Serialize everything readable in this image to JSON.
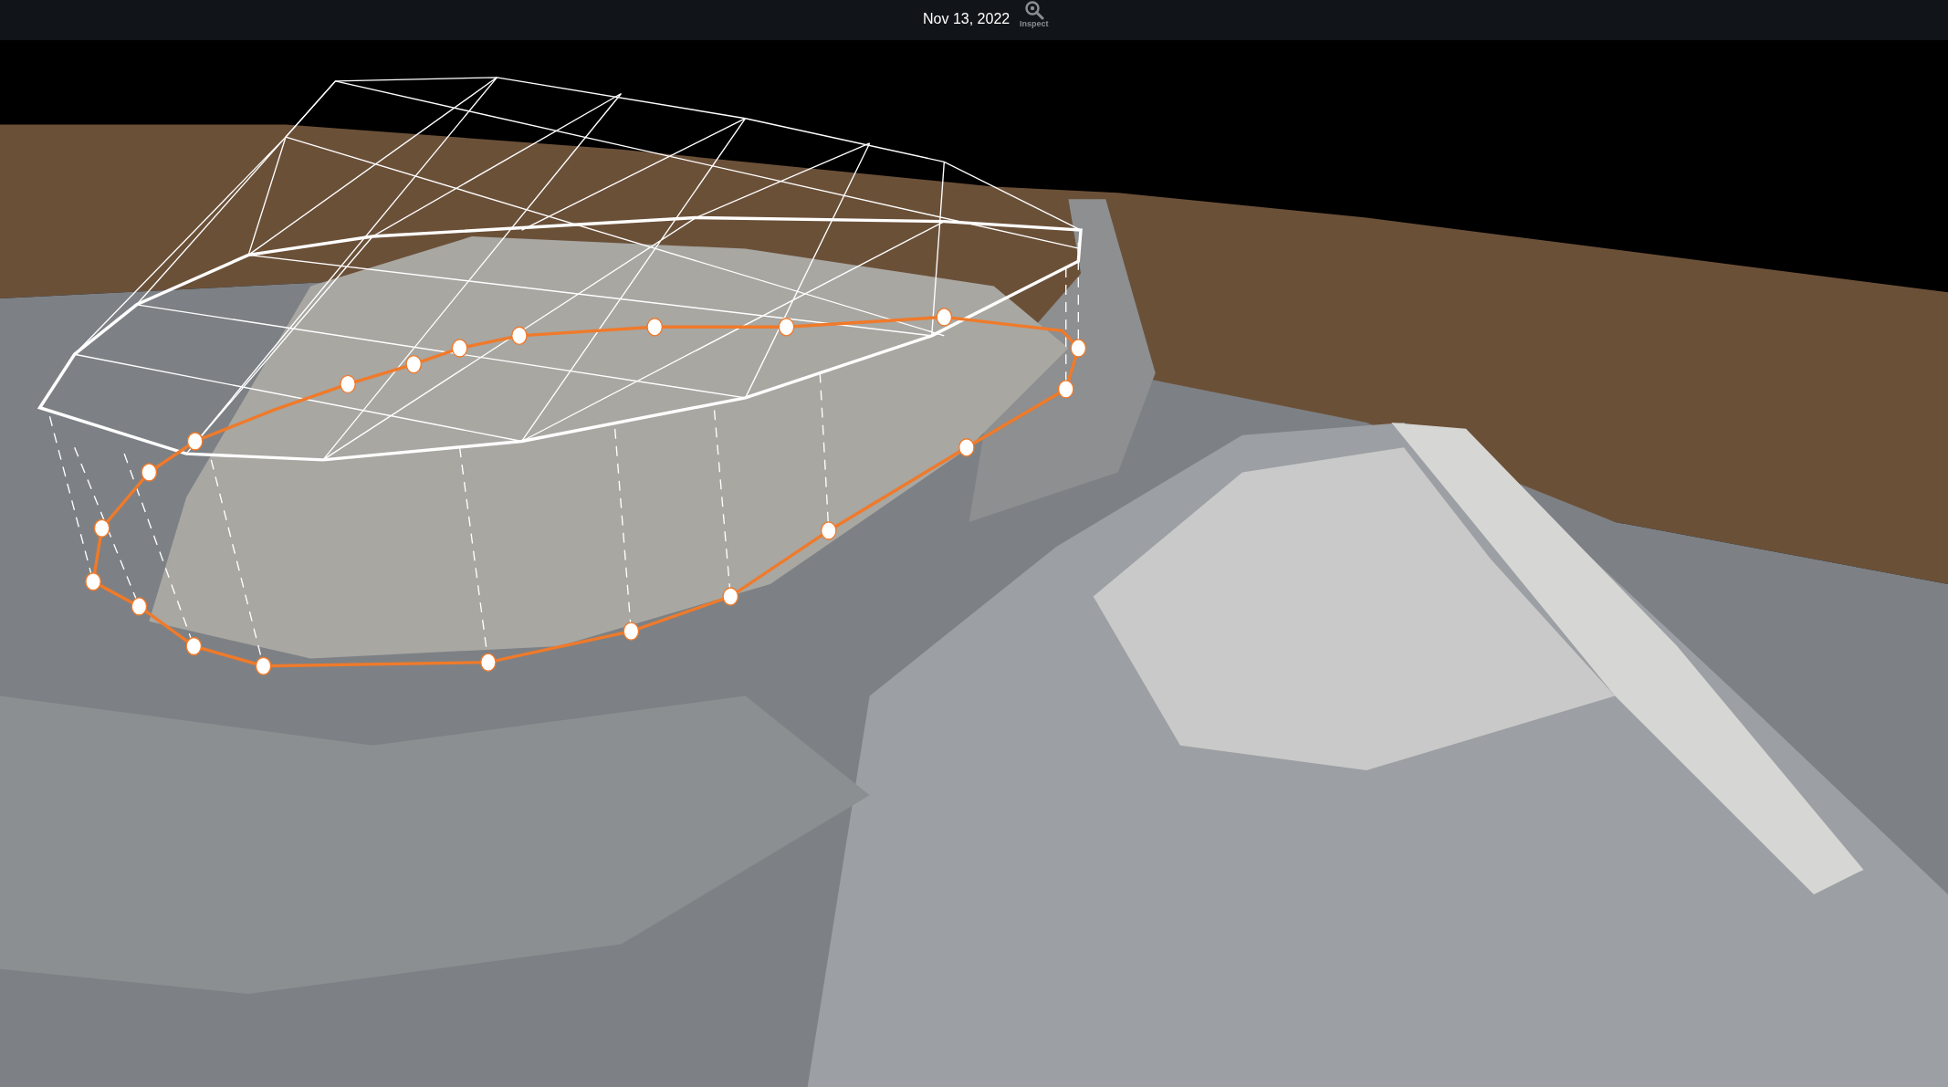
{
  "top_bar": {
    "date": "Nov 13, 2022",
    "inspect_button": {
      "label": "Inspect"
    }
  }
}
